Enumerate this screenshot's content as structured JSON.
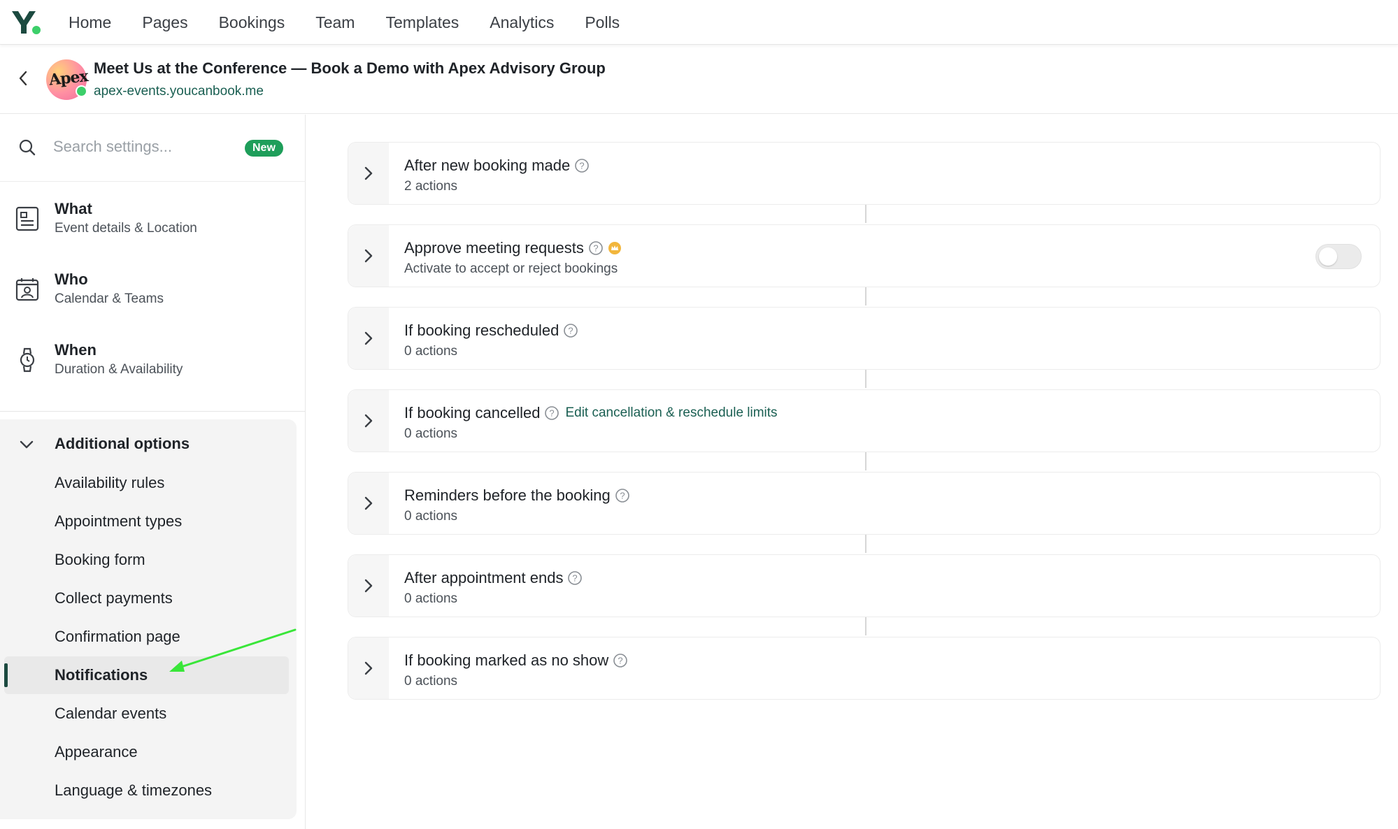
{
  "topnav": {
    "logo": "Y",
    "items": [
      "Home",
      "Pages",
      "Bookings",
      "Team",
      "Templates",
      "Analytics",
      "Polls"
    ]
  },
  "header": {
    "title": "Meet Us at the Conference — Book a Demo with Apex Advisory Group",
    "url": "apex-events.youcanbook.me",
    "avatar_text": "Apex"
  },
  "sidebar": {
    "search_placeholder": "Search settings...",
    "new_badge": "New",
    "sections": [
      {
        "title": "What",
        "subtitle": "Event details & Location",
        "icon": "event-details-icon"
      },
      {
        "title": "Who",
        "subtitle": "Calendar & Teams",
        "icon": "calendar-person-icon"
      },
      {
        "title": "When",
        "subtitle": "Duration & Availability",
        "icon": "watch-icon"
      }
    ],
    "additional": {
      "title": "Additional options",
      "items": [
        "Availability rules",
        "Appointment types",
        "Booking form",
        "Collect payments",
        "Confirmation page",
        "Notifications",
        "Calendar events",
        "Appearance",
        "Language & timezones"
      ],
      "active": "Notifications"
    }
  },
  "cards": [
    {
      "title": "After new booking made",
      "subtitle": "2 actions"
    },
    {
      "title": "Approve meeting requests",
      "subtitle": "Activate to accept or reject bookings",
      "toggle": "off"
    },
    {
      "title": "If booking rescheduled",
      "subtitle": "0 actions"
    },
    {
      "title": "If booking cancelled",
      "subtitle": "0 actions",
      "link": "Edit cancellation & reschedule limits"
    },
    {
      "title": "Reminders before the booking",
      "subtitle": "0 actions"
    },
    {
      "title": "After appointment ends",
      "subtitle": "0 actions"
    },
    {
      "title": "If booking marked as no show",
      "subtitle": "0 actions"
    }
  ],
  "colors": {
    "brand_green": "#1c4a40",
    "link_green": "#1a5f52",
    "badge_green": "#1e9e5a",
    "annotation_arrow": "#39e639"
  }
}
